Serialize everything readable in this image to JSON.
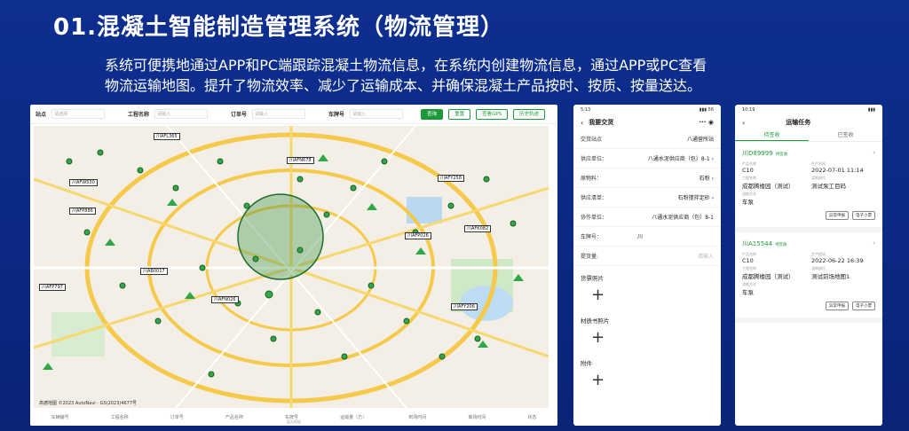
{
  "slide": {
    "title": "01.混凝土智能制造管理系统（物流管理）",
    "desc_line1": "系统可便携地通过APP和PC端跟踪混凝土物流信息，在系统内创建物流信息，通过APP或PC查看",
    "desc_line2": "物流运输地图。提升了物流效率、减少了运输成本、并确保混凝土产品按时、按质、按量送达。"
  },
  "desktop": {
    "filters": [
      {
        "label": "站点",
        "placeholder": "请选择"
      },
      {
        "label": "工程名称",
        "placeholder": "请输入"
      },
      {
        "label": "订单号",
        "placeholder": "请输入"
      },
      {
        "label": "车牌号",
        "placeholder": "请输入"
      }
    ],
    "buttons": {
      "query": "查询",
      "reset": "重置",
      "gps": "查看GPS",
      "track": "历史轨迹"
    },
    "map_labels": [
      "川AFL365",
      "川AFN678",
      "川AFY258",
      "川AFK082",
      "川AFP026",
      "川AFP886",
      "川AB0017",
      "川AFP797",
      "川AFN026",
      "川AFY206",
      "川AFW530"
    ],
    "map_attrib": "高德地图 ©2023 AutoNavi - GS(2023)4677号",
    "footer_cols": [
      "车辆编号",
      "工程名称",
      "订单号",
      "产品名称",
      "车牌号",
      "运输量（方）",
      "到场时间",
      "离场时间",
      "状态"
    ],
    "footer_center": "暂无数据"
  },
  "phone1": {
    "time": "5:13",
    "signal": "▮▮▮ 56",
    "title": "我要交货",
    "rows": [
      {
        "k": "交货站点",
        "v": "八通营所站"
      },
      {
        "k": "供应单位：",
        "v": "八通水泥供应商（包）8-1 ›"
      },
      {
        "k": "原物料：",
        "v": "石粉 ›"
      },
      {
        "k": "供应清单：",
        "v": "石粉搅拌定砂 ›"
      },
      {
        "k": "协作单位：",
        "v": "八通水泥供应商（包）8-1"
      },
      {
        "k": "车牌号：",
        "v": "川"
      },
      {
        "k": "提货量:",
        "v": "请输入"
      }
    ],
    "sections": [
      "货票照片",
      "材质书照片",
      "附件"
    ],
    "plus": "+"
  },
  "phone2": {
    "time": "10:19",
    "title": "运输任务",
    "tabs": [
      "待签收",
      "已签收"
    ],
    "tasks": [
      {
        "plate": "川D89999",
        "state": "待签收",
        "fields": [
          {
            "k": "产品名称",
            "v": "C10"
          },
          {
            "k": "生产时间",
            "v": "2022-07-01 11:14"
          },
          {
            "k": "工程名称",
            "v": "成都腾楼园（测试）"
          },
          {
            "k": "浇筑部位",
            "v": "测试泵工目码"
          },
          {
            "k": "浇筑方式",
            "v": "车泵"
          },
          {
            "k": "",
            "v": ""
          }
        ],
        "btns": [
          "异常申报",
          "电子小票"
        ]
      },
      {
        "plate": "川A15544",
        "state": "待签收",
        "fields": [
          {
            "k": "产品名称",
            "v": "C10"
          },
          {
            "k": "生产时间",
            "v": "2022-06-22 16:39"
          },
          {
            "k": "工程名称",
            "v": "成都腾楼园（测试）"
          },
          {
            "k": "浇筑部位",
            "v": "测试前场地图1"
          },
          {
            "k": "浇筑方式",
            "v": "车泵"
          },
          {
            "k": "",
            "v": ""
          }
        ],
        "btns": [
          "异常申报",
          "电子小票"
        ]
      }
    ]
  },
  "colors": {
    "accent": "#1c9a3a",
    "bg": "#0b2a86"
  }
}
